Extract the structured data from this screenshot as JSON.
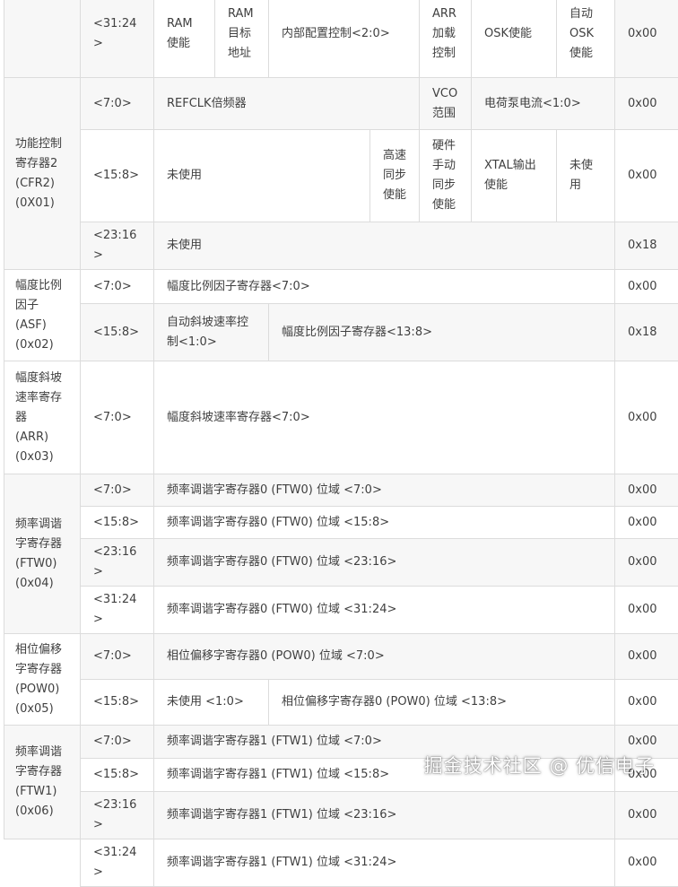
{
  "rows": {
    "r0": {
      "bits": "<31:24>",
      "c1": "RAM\n使能",
      "c2": "RAM\n目标\n地址",
      "c3": "内部配置控制<2:0>",
      "c4": "ARR\n加载\n控制",
      "c5": "OSK使能",
      "c6": "自动\nOSK\n使能",
      "val": "0x00"
    },
    "cfr2": {
      "name": "功能控制\n寄存器2\n(CFR2)\n(0X01)"
    },
    "r1": {
      "bits": "<7:0>",
      "c1": "REFCLK倍频器",
      "c2": "VCO\n范围",
      "c3": "电荷泵电流<1:0>",
      "val": "0x00"
    },
    "r2": {
      "bits": "<15:8>",
      "c1": "未使用",
      "c2": "高速\n同步\n使能",
      "c3": "硬件\n手动\n同步\n使能",
      "c4": "XTAL输出\n使能",
      "c5": "未使\n用",
      "val": "0x00"
    },
    "r3": {
      "bits": "<23:16>",
      "c1": "未使用",
      "val": "0x18"
    },
    "asf": {
      "name": "幅度比例\n因子\n(ASF)\n(0x02)"
    },
    "r4": {
      "bits": "<7:0>",
      "c1": "幅度比例因子寄存器<7:0>",
      "val": "0x00"
    },
    "r5": {
      "bits": "<15:8>",
      "c1": "自动斜坡速率控\n制<1:0>",
      "c2": "幅度比例因子寄存器<13:8>",
      "val": "0x18"
    },
    "arr": {
      "name": "幅度斜坡\n速率寄存\n器\n(ARR)\n(0x03)"
    },
    "r6": {
      "bits": "<7:0>",
      "c1": "幅度斜坡速率寄存器<7:0>",
      "val": "0x00"
    },
    "ftw0": {
      "name": "频率调谐\n字寄存器\n(FTW0)\n(0x04)"
    },
    "r7": {
      "bits": "<7:0>",
      "c1": "频率调谐字寄存器0 (FTW0) 位域 <7:0>",
      "val": "0x00"
    },
    "r8": {
      "bits": "<15:8>",
      "c1": "频率调谐字寄存器0 (FTW0) 位域 <15:8>",
      "val": "0x00"
    },
    "r9": {
      "bits": "<23:16>",
      "c1": "频率调谐字寄存器0 (FTW0) 位域 <23:16>",
      "val": "0x00"
    },
    "r10": {
      "bits": "<31:24>",
      "c1": "频率调谐字寄存器0 (FTW0) 位域 <31:24>",
      "val": "0x00"
    },
    "pow0": {
      "name": "相位偏移\n字寄存器\n(POW0)\n(0x05)"
    },
    "r11": {
      "bits": "<7:0>",
      "c1": "相位偏移字寄存器0 (POW0) 位域 <7:0>",
      "val": "0x00"
    },
    "r12": {
      "bits": "<15:8>",
      "c1": "未使用 <1:0>",
      "c2": "相位偏移字寄存器0 (POW0) 位域 <13:8>",
      "val": "0x00"
    },
    "ftw1": {
      "name": "频率调谐\n字寄存器\n(FTW1)\n(0x06)"
    },
    "r13": {
      "bits": "<7:0>",
      "c1": "频率调谐字寄存器1 (FTW1) 位域 <7:0>",
      "val": "0x00"
    },
    "r14": {
      "bits": "<15:8>",
      "c1": "频率调谐字寄存器1 (FTW1) 位域 <15:8>",
      "val": "0x00"
    },
    "r15": {
      "bits": "<23:16>",
      "c1": "频率调谐字寄存器1 (FTW1) 位域 <23:16>",
      "val": "0x00"
    },
    "r16": {
      "bits": "<31:24>",
      "c1": "频率调谐字寄存器1 (FTW1) 位域 <31:24>",
      "val": "0x00"
    }
  },
  "watermark": "掘金技术社区 @ 优信电子"
}
